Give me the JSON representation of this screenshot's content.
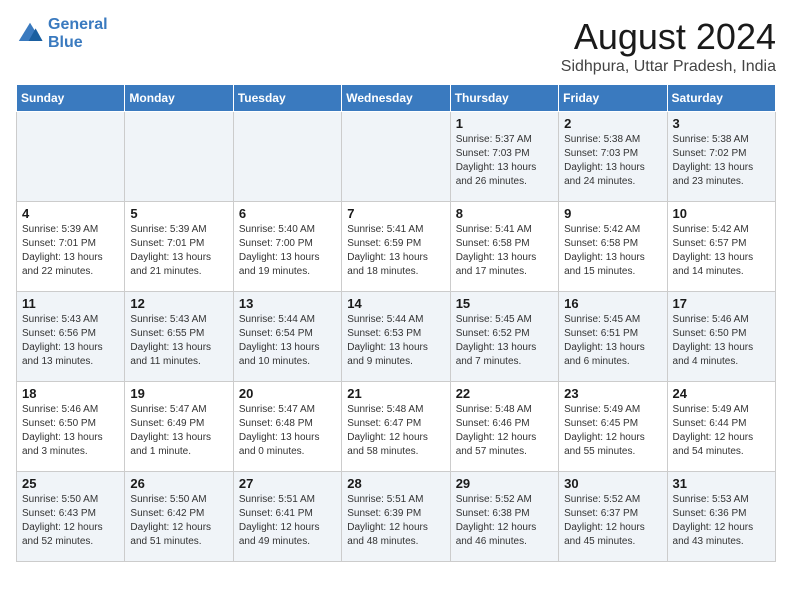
{
  "header": {
    "logo_line1": "General",
    "logo_line2": "Blue",
    "main_title": "August 2024",
    "subtitle": "Sidhpura, Uttar Pradesh, India"
  },
  "days_of_week": [
    "Sunday",
    "Monday",
    "Tuesday",
    "Wednesday",
    "Thursday",
    "Friday",
    "Saturday"
  ],
  "weeks": [
    [
      {
        "day": "",
        "info": ""
      },
      {
        "day": "",
        "info": ""
      },
      {
        "day": "",
        "info": ""
      },
      {
        "day": "",
        "info": ""
      },
      {
        "day": "1",
        "info": "Sunrise: 5:37 AM\nSunset: 7:03 PM\nDaylight: 13 hours\nand 26 minutes."
      },
      {
        "day": "2",
        "info": "Sunrise: 5:38 AM\nSunset: 7:03 PM\nDaylight: 13 hours\nand 24 minutes."
      },
      {
        "day": "3",
        "info": "Sunrise: 5:38 AM\nSunset: 7:02 PM\nDaylight: 13 hours\nand 23 minutes."
      }
    ],
    [
      {
        "day": "4",
        "info": "Sunrise: 5:39 AM\nSunset: 7:01 PM\nDaylight: 13 hours\nand 22 minutes."
      },
      {
        "day": "5",
        "info": "Sunrise: 5:39 AM\nSunset: 7:01 PM\nDaylight: 13 hours\nand 21 minutes."
      },
      {
        "day": "6",
        "info": "Sunrise: 5:40 AM\nSunset: 7:00 PM\nDaylight: 13 hours\nand 19 minutes."
      },
      {
        "day": "7",
        "info": "Sunrise: 5:41 AM\nSunset: 6:59 PM\nDaylight: 13 hours\nand 18 minutes."
      },
      {
        "day": "8",
        "info": "Sunrise: 5:41 AM\nSunset: 6:58 PM\nDaylight: 13 hours\nand 17 minutes."
      },
      {
        "day": "9",
        "info": "Sunrise: 5:42 AM\nSunset: 6:58 PM\nDaylight: 13 hours\nand 15 minutes."
      },
      {
        "day": "10",
        "info": "Sunrise: 5:42 AM\nSunset: 6:57 PM\nDaylight: 13 hours\nand 14 minutes."
      }
    ],
    [
      {
        "day": "11",
        "info": "Sunrise: 5:43 AM\nSunset: 6:56 PM\nDaylight: 13 hours\nand 13 minutes."
      },
      {
        "day": "12",
        "info": "Sunrise: 5:43 AM\nSunset: 6:55 PM\nDaylight: 13 hours\nand 11 minutes."
      },
      {
        "day": "13",
        "info": "Sunrise: 5:44 AM\nSunset: 6:54 PM\nDaylight: 13 hours\nand 10 minutes."
      },
      {
        "day": "14",
        "info": "Sunrise: 5:44 AM\nSunset: 6:53 PM\nDaylight: 13 hours\nand 9 minutes."
      },
      {
        "day": "15",
        "info": "Sunrise: 5:45 AM\nSunset: 6:52 PM\nDaylight: 13 hours\nand 7 minutes."
      },
      {
        "day": "16",
        "info": "Sunrise: 5:45 AM\nSunset: 6:51 PM\nDaylight: 13 hours\nand 6 minutes."
      },
      {
        "day": "17",
        "info": "Sunrise: 5:46 AM\nSunset: 6:50 PM\nDaylight: 13 hours\nand 4 minutes."
      }
    ],
    [
      {
        "day": "18",
        "info": "Sunrise: 5:46 AM\nSunset: 6:50 PM\nDaylight: 13 hours\nand 3 minutes."
      },
      {
        "day": "19",
        "info": "Sunrise: 5:47 AM\nSunset: 6:49 PM\nDaylight: 13 hours\nand 1 minute."
      },
      {
        "day": "20",
        "info": "Sunrise: 5:47 AM\nSunset: 6:48 PM\nDaylight: 13 hours\nand 0 minutes."
      },
      {
        "day": "21",
        "info": "Sunrise: 5:48 AM\nSunset: 6:47 PM\nDaylight: 12 hours\nand 58 minutes."
      },
      {
        "day": "22",
        "info": "Sunrise: 5:48 AM\nSunset: 6:46 PM\nDaylight: 12 hours\nand 57 minutes."
      },
      {
        "day": "23",
        "info": "Sunrise: 5:49 AM\nSunset: 6:45 PM\nDaylight: 12 hours\nand 55 minutes."
      },
      {
        "day": "24",
        "info": "Sunrise: 5:49 AM\nSunset: 6:44 PM\nDaylight: 12 hours\nand 54 minutes."
      }
    ],
    [
      {
        "day": "25",
        "info": "Sunrise: 5:50 AM\nSunset: 6:43 PM\nDaylight: 12 hours\nand 52 minutes."
      },
      {
        "day": "26",
        "info": "Sunrise: 5:50 AM\nSunset: 6:42 PM\nDaylight: 12 hours\nand 51 minutes."
      },
      {
        "day": "27",
        "info": "Sunrise: 5:51 AM\nSunset: 6:41 PM\nDaylight: 12 hours\nand 49 minutes."
      },
      {
        "day": "28",
        "info": "Sunrise: 5:51 AM\nSunset: 6:39 PM\nDaylight: 12 hours\nand 48 minutes."
      },
      {
        "day": "29",
        "info": "Sunrise: 5:52 AM\nSunset: 6:38 PM\nDaylight: 12 hours\nand 46 minutes."
      },
      {
        "day": "30",
        "info": "Sunrise: 5:52 AM\nSunset: 6:37 PM\nDaylight: 12 hours\nand 45 minutes."
      },
      {
        "day": "31",
        "info": "Sunrise: 5:53 AM\nSunset: 6:36 PM\nDaylight: 12 hours\nand 43 minutes."
      }
    ]
  ]
}
